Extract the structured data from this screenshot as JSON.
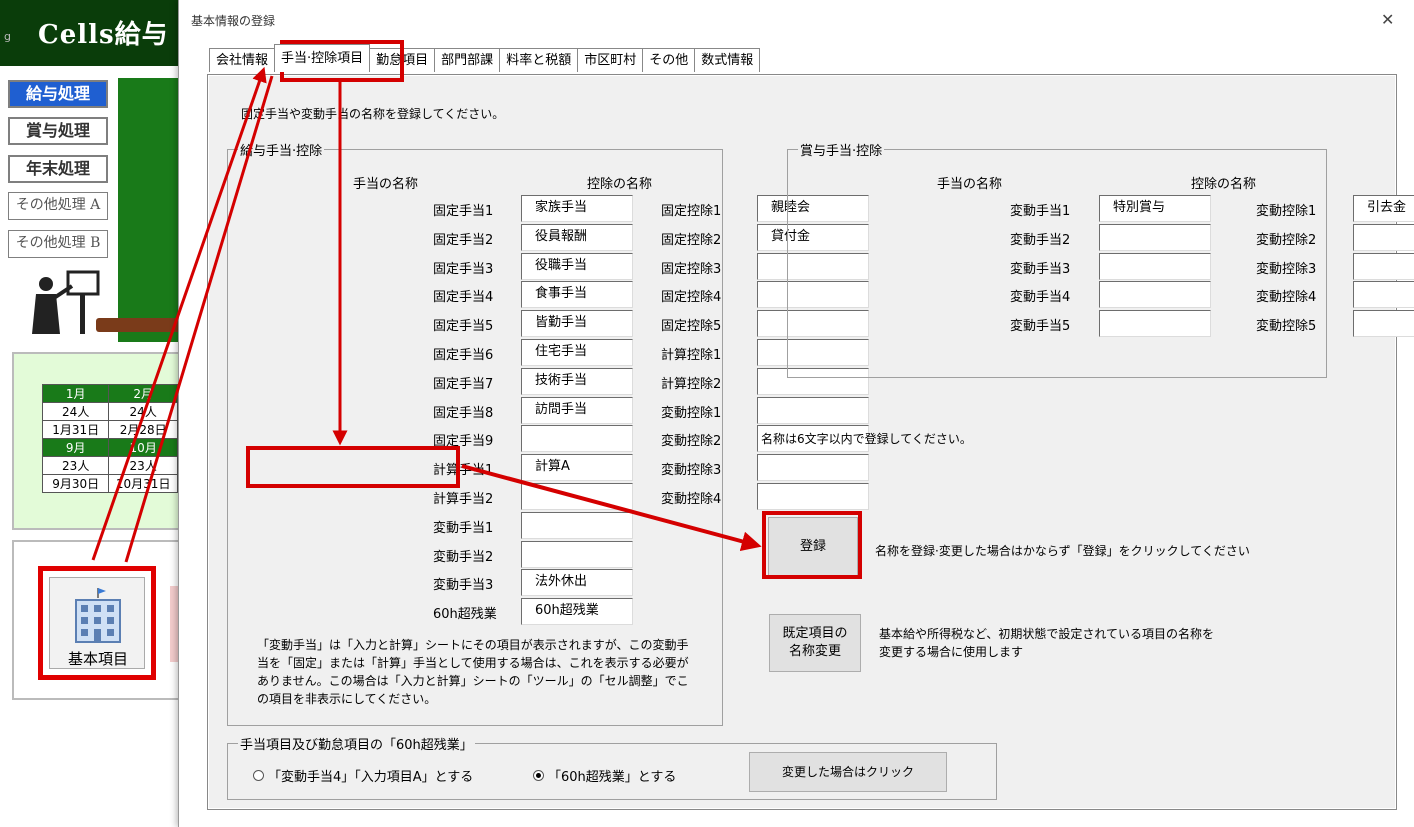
{
  "background": {
    "prefix": "g",
    "app_title": "Cells給与",
    "menu": [
      "給与処理",
      "賞与処理",
      "年末処理",
      "その他処理 A",
      "その他処理 B"
    ],
    "calendar": [
      [
        "1月",
        "2月"
      ],
      [
        "24人",
        "24人"
      ],
      [
        "1月31日",
        "2月28日"
      ],
      [
        "9月",
        "10月"
      ],
      [
        "23人",
        "23人"
      ],
      [
        "9月30日",
        "10月31日"
      ]
    ],
    "kihon_button": "基本項目"
  },
  "dialog": {
    "title": "基本情報の登録",
    "close": "✕",
    "tabs": [
      "会社情報",
      "手当·控除項目",
      "勤怠項目",
      "部門部課",
      "料率と税額",
      "市区町村",
      "その他",
      "数式情報"
    ],
    "selected_tab": "手当·控除項目",
    "intro": "固定手当や変動手当の名称を登録してください。",
    "kyuyo": {
      "legend": "給与手当·控除",
      "col_allow": "手当の名称",
      "col_deduct": "控除の名称",
      "allowances": [
        {
          "label": "固定手当1",
          "value": "家族手当"
        },
        {
          "label": "固定手当2",
          "value": "役員報酬"
        },
        {
          "label": "固定手当3",
          "value": "役職手当"
        },
        {
          "label": "固定手当4",
          "value": "食事手当"
        },
        {
          "label": "固定手当5",
          "value": "皆勤手当"
        },
        {
          "label": "固定手当6",
          "value": "住宅手当"
        },
        {
          "label": "固定手当7",
          "value": "技術手当"
        },
        {
          "label": "固定手当8",
          "value": "訪問手当"
        },
        {
          "label": "固定手当9",
          "value": ""
        },
        {
          "label": "計算手当1",
          "value": "計算A"
        },
        {
          "label": "計算手当2",
          "value": ""
        },
        {
          "label": "変動手当1",
          "value": ""
        },
        {
          "label": "変動手当2",
          "value": ""
        },
        {
          "label": "変動手当3",
          "value": "法外休出"
        },
        {
          "label": "60h超残業",
          "value": "60h超残業"
        }
      ],
      "deductions": [
        {
          "label": "固定控除1",
          "value": "親睦会"
        },
        {
          "label": "固定控除2",
          "value": "貸付金"
        },
        {
          "label": "固定控除3",
          "value": ""
        },
        {
          "label": "固定控除4",
          "value": ""
        },
        {
          "label": "固定控除5",
          "value": ""
        },
        {
          "label": "計算控除1",
          "value": ""
        },
        {
          "label": "計算控除2",
          "value": ""
        },
        {
          "label": "変動控除1",
          "value": ""
        },
        {
          "label": "変動控除2",
          "value": ""
        },
        {
          "label": "変動控除3",
          "value": ""
        },
        {
          "label": "変動控除4",
          "value": ""
        }
      ],
      "note": "「変動手当」は「入力と計算」シートにその項目が表示されますが、この変動手当を「固定」または「計算」手当として使用する場合は、これを表示する必要がありません。この場合は「入力と計算」シートの「ツール」の「セル調整」でこの項目を非表示にしてください。"
    },
    "shoyo": {
      "legend": "賞与手当·控除",
      "col_allow": "手当の名称",
      "col_deduct": "控除の名称",
      "allowances": [
        {
          "label": "変動手当1",
          "value": "特別賞与"
        },
        {
          "label": "変動手当2",
          "value": ""
        },
        {
          "label": "変動手当3",
          "value": ""
        },
        {
          "label": "変動手当4",
          "value": ""
        },
        {
          "label": "変動手当5",
          "value": ""
        }
      ],
      "deductions": [
        {
          "label": "変動控除1",
          "value": "引去金"
        },
        {
          "label": "変動控除2",
          "value": ""
        },
        {
          "label": "変動控除3",
          "value": ""
        },
        {
          "label": "変動控除4",
          "value": ""
        },
        {
          "label": "変動控除5",
          "value": ""
        }
      ]
    },
    "name_limit_note": "名称は6文字以内で登録してください。",
    "register_button": "登録",
    "register_note": "名称を登録·変更した場合はかならず「登録」をクリックしてください",
    "default_names_button": [
      "既定項目の",
      "名称変更"
    ],
    "default_names_note": [
      "基本給や所得税など、初期状態で設定されている項目の名称を",
      "変更する場合に使用します"
    ],
    "ot60": {
      "legend": "手当項目及び勤怠項目の「60h超残業」",
      "option1": "「変動手当4」「入力項目A」とする",
      "option2": "「60h超残業」とする",
      "selected": 2,
      "apply_button": "変更した場合はクリック"
    }
  },
  "colors": {
    "annotation": "#d40000",
    "header_green": "#0a3d0a",
    "active_menu": "#1f5fd1"
  }
}
